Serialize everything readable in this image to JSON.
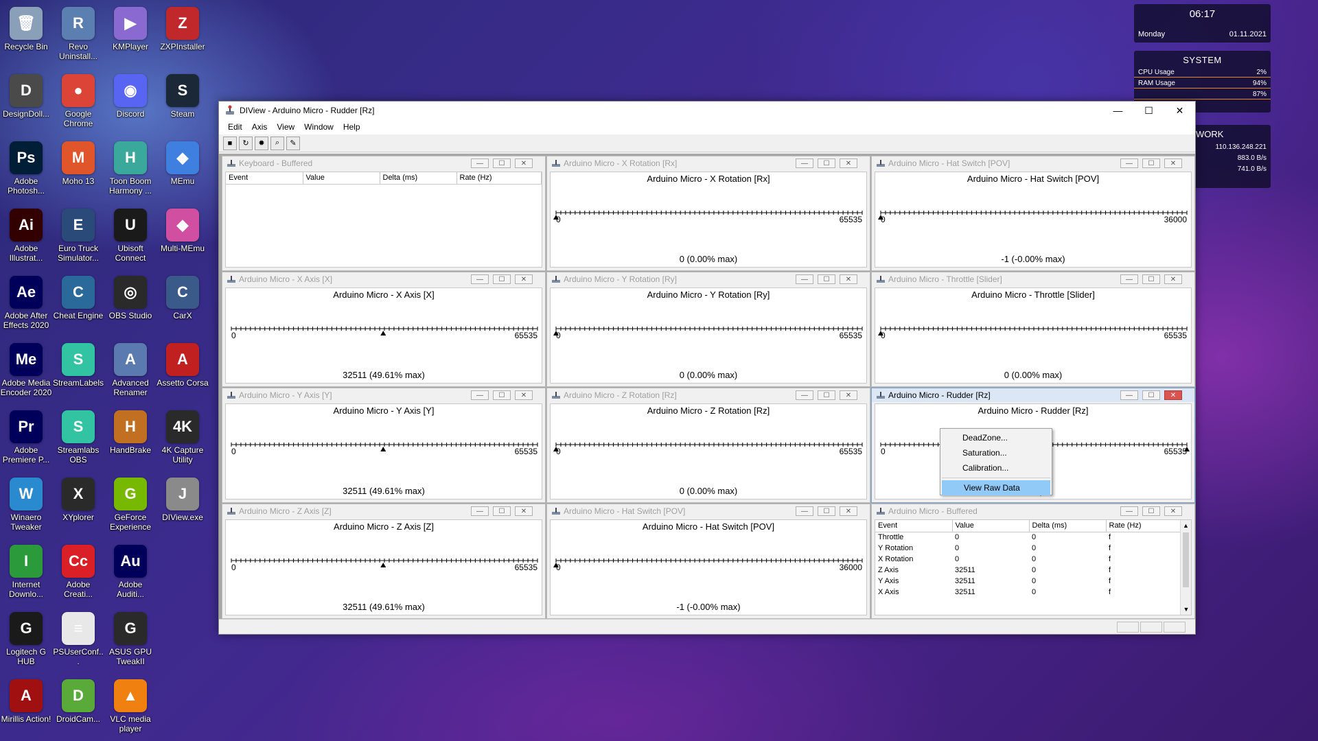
{
  "desktop": {
    "icons": [
      {
        "label": "Recycle Bin",
        "glyph": "🗑",
        "color": "#8aa0b8",
        "icon": "recycle-bin-icon"
      },
      {
        "label": "Revo Uninstall...",
        "glyph": "R",
        "color": "#5b7fb0",
        "icon": "revo-uninstaller-icon"
      },
      {
        "label": "KMPlayer",
        "glyph": "▶",
        "color": "#8a6ad0",
        "icon": "kmplayer-icon"
      },
      {
        "label": "ZXPInstaller",
        "glyph": "Z",
        "color": "#c0282c",
        "icon": "zxpinstaller-icon"
      },
      {
        "label": "DesignDoll...",
        "glyph": "D",
        "color": "#4a4a4a",
        "icon": "designdoll-icon"
      },
      {
        "label": "Google Chrome",
        "glyph": "●",
        "color": "#db4437",
        "icon": "chrome-icon"
      },
      {
        "label": "Discord",
        "glyph": "◉",
        "color": "#5865f2",
        "icon": "discord-icon"
      },
      {
        "label": "Steam",
        "glyph": "S",
        "color": "#1b2838",
        "icon": "steam-icon"
      },
      {
        "label": "Adobe Photosh...",
        "glyph": "Ps",
        "color": "#001e36",
        "icon": "photoshop-icon"
      },
      {
        "label": "Moho 13",
        "glyph": "M",
        "color": "#e0552a",
        "icon": "moho-icon"
      },
      {
        "label": "Toon Boom Harmony ...",
        "glyph": "H",
        "color": "#3aa89a",
        "icon": "toon-boom-icon"
      },
      {
        "label": "MEmu",
        "glyph": "◆",
        "color": "#3f7fe0",
        "icon": "memu-icon"
      },
      {
        "label": "Adobe Illustrat...",
        "glyph": "Ai",
        "color": "#330000",
        "icon": "illustrator-icon"
      },
      {
        "label": "Euro Truck Simulator...",
        "glyph": "E",
        "color": "#2a4a7a",
        "icon": "euro-truck-icon"
      },
      {
        "label": "Ubisoft Connect",
        "glyph": "U",
        "color": "#1a1a1a",
        "icon": "ubisoft-icon"
      },
      {
        "label": "Multi-MEmu",
        "glyph": "◆",
        "color": "#d04fa0",
        "icon": "multi-memu-icon"
      },
      {
        "label": "Adobe After Effects 2020",
        "glyph": "Ae",
        "color": "#00005b",
        "icon": "after-effects-icon"
      },
      {
        "label": "Cheat Engine",
        "glyph": "C",
        "color": "#2a6a9a",
        "icon": "cheat-engine-icon"
      },
      {
        "label": "OBS Studio",
        "glyph": "◎",
        "color": "#2a2a2a",
        "icon": "obs-icon"
      },
      {
        "label": "CarX",
        "glyph": "C",
        "color": "#3a5a8a",
        "icon": "carx-icon"
      },
      {
        "label": "Adobe Media Encoder 2020",
        "glyph": "Me",
        "color": "#00005b",
        "icon": "media-encoder-icon"
      },
      {
        "label": "StreamLabels",
        "glyph": "S",
        "color": "#31c3a2",
        "icon": "streamlabels-icon"
      },
      {
        "label": "Advanced Renamer",
        "glyph": "A",
        "color": "#5a7ab0",
        "icon": "advanced-renamer-icon"
      },
      {
        "label": "Assetto Corsa",
        "glyph": "A",
        "color": "#c02020",
        "icon": "assetto-corsa-icon"
      },
      {
        "label": "Adobe Premiere P...",
        "glyph": "Pr",
        "color": "#00005b",
        "icon": "premiere-icon"
      },
      {
        "label": "Streamlabs OBS",
        "glyph": "S",
        "color": "#31c3a2",
        "icon": "streamlabs-obs-icon"
      },
      {
        "label": "HandBrake",
        "glyph": "H",
        "color": "#c07020",
        "icon": "handbrake-icon"
      },
      {
        "label": "4K Capture Utility",
        "glyph": "4K",
        "color": "#2a2a2a",
        "icon": "4k-capture-icon"
      },
      {
        "label": "Winaero Tweaker",
        "glyph": "W",
        "color": "#2a8ad0",
        "icon": "winaero-icon"
      },
      {
        "label": "XYplorer",
        "glyph": "X",
        "color": "#2a2a2a",
        "icon": "xyplorer-icon"
      },
      {
        "label": "GeForce Experience",
        "glyph": "G",
        "color": "#76b900",
        "icon": "geforce-icon"
      },
      {
        "label": "DIView.exe",
        "glyph": "J",
        "color": "#8a8a8a",
        "icon": "diview-exe-icon"
      },
      {
        "label": "Internet Downlo...",
        "glyph": "I",
        "color": "#2a9a3a",
        "icon": "idm-icon"
      },
      {
        "label": "Adobe Creati...",
        "glyph": "Cc",
        "color": "#da1f26",
        "icon": "creative-cloud-icon"
      },
      {
        "label": "Adobe Auditi...",
        "glyph": "Au",
        "color": "#00005b",
        "icon": "audition-icon"
      },
      {
        "label": "",
        "glyph": "",
        "color": "transparent",
        "icon": "empty-slot"
      },
      {
        "label": "Logitech G HUB",
        "glyph": "G",
        "color": "#1a1a1a",
        "icon": "logitech-icon"
      },
      {
        "label": "PSUserConf...",
        "glyph": "≡",
        "color": "#e8e8e8",
        "icon": "file-icon"
      },
      {
        "label": "ASUS GPU TweakII",
        "glyph": "G",
        "color": "#2a2a2a",
        "icon": "asus-gpu-icon"
      },
      {
        "label": "",
        "glyph": "",
        "color": "transparent",
        "icon": "empty-slot"
      },
      {
        "label": "Mirillis Action!",
        "glyph": "A",
        "color": "#a01010",
        "icon": "mirillis-icon"
      },
      {
        "label": "DroidCam...",
        "glyph": "D",
        "color": "#5aaa3a",
        "icon": "droidcam-icon"
      },
      {
        "label": "VLC media player",
        "glyph": "▲",
        "color": "#f08010",
        "icon": "vlc-icon"
      }
    ]
  },
  "widgets": {
    "clock": {
      "time": "06:17",
      "day": "Monday",
      "date": "01.11.2021"
    },
    "system": {
      "title": "SYSTEM",
      "cpu_label": "CPU Usage",
      "cpu_value": "2%",
      "ram_label": "RAM Usage",
      "ram_value": "94%",
      "third_value": "87%"
    },
    "network": {
      "title": "WORK",
      "ip": "110.136.248.221",
      "down": "883.0 B/s",
      "up": "741.0 B/s"
    }
  },
  "window": {
    "title": "DIView - Arduino Micro - Rudder [Rz]",
    "menu": [
      "Edit",
      "Axis",
      "View",
      "Window",
      "Help"
    ],
    "toolbar": [
      {
        "glyph": "■",
        "icon": "save-icon"
      },
      {
        "glyph": "↻",
        "icon": "refresh-icon"
      },
      {
        "glyph": "✹",
        "icon": "settings-icon"
      },
      {
        "glyph": "⌕",
        "icon": "zoom-icon"
      },
      {
        "glyph": "✎",
        "icon": "edit-icon"
      }
    ],
    "controls": {
      "minimize": "—",
      "maximize": "☐",
      "close": "✕"
    }
  },
  "panels": {
    "kbd": {
      "title": "Keyboard - Buffered",
      "headers": [
        "Event",
        "Value",
        "Delta (ms)",
        "Rate (Hz)"
      ]
    },
    "rx": {
      "title": "Arduino Micro - X Rotation [Rx]",
      "label": "Arduino Micro - X Rotation [Rx]",
      "min": "0",
      "max": "65535",
      "value": "0 (0.00% max)",
      "pos": 0
    },
    "pov1": {
      "title": "Arduino Micro - Hat Switch [POV]",
      "label": "Arduino Micro - Hat Switch [POV]",
      "min": "0",
      "max": "36000",
      "value": "-1 (-0.00% max)",
      "pos": 0
    },
    "x": {
      "title": "Arduino Micro - X Axis [X]",
      "label": "Arduino Micro - X Axis [X]",
      "min": "0",
      "max": "65535",
      "value": "32511 (49.61% max)",
      "pos": 0.4961
    },
    "ry": {
      "title": "Arduino Micro - Y Rotation [Ry]",
      "label": "Arduino Micro - Y Rotation [Ry]",
      "min": "0",
      "max": "65535",
      "value": "0 (0.00% max)",
      "pos": 0
    },
    "slider": {
      "title": "Arduino Micro - Throttle [Slider]",
      "label": "Arduino Micro - Throttle [Slider]",
      "min": "0",
      "max": "65535",
      "value": "0 (0.00% max)",
      "pos": 0
    },
    "y": {
      "title": "Arduino Micro - Y Axis [Y]",
      "label": "Arduino Micro - Y Axis [Y]",
      "min": "0",
      "max": "65535",
      "value": "32511 (49.61% max)",
      "pos": 0.4961
    },
    "rz_rot": {
      "title": "Arduino Micro - Z Rotation [Rz]",
      "label": "Arduino Micro - Z Rotation [Rz]",
      "min": "0",
      "max": "65535",
      "value": "0 (0.00% max)",
      "pos": 0
    },
    "rudder": {
      "title": "Arduino Micro - Rudder [Rz]",
      "label": "Arduino Micro - Rudder [Rz]",
      "min": "0",
      "max": "65535",
      "value": "max)",
      "pos": 1
    },
    "z": {
      "title": "Arduino Micro - Z Axis [Z]",
      "label": "Arduino Micro - Z Axis [Z]",
      "min": "0",
      "max": "65535",
      "value": "32511 (49.61% max)",
      "pos": 0.4961
    },
    "pov2": {
      "title": "Arduino Micro - Hat Switch [POV]",
      "label": "Arduino Micro - Hat Switch [POV]",
      "min": "0",
      "max": "36000",
      "value": "-1 (-0.00% max)",
      "pos": 0
    },
    "buffered": {
      "title": "Arduino Micro - Buffered",
      "headers": [
        "Event",
        "Value",
        "Delta (ms)",
        "Rate (Hz)"
      ],
      "rows": [
        [
          "Throttle",
          "0",
          "0",
          "f"
        ],
        [
          "Y Rotation",
          "0",
          "0",
          "f"
        ],
        [
          "X Rotation",
          "0",
          "0",
          "f"
        ],
        [
          "Z Axis",
          "32511",
          "0",
          "f"
        ],
        [
          "Y Axis",
          "32511",
          "0",
          "f"
        ],
        [
          "X Axis",
          "32511",
          "0",
          "f"
        ]
      ]
    }
  },
  "context_menu": {
    "items": [
      "DeadZone...",
      "Saturation...",
      "Calibration..."
    ],
    "highlighted": "View Raw Data"
  }
}
